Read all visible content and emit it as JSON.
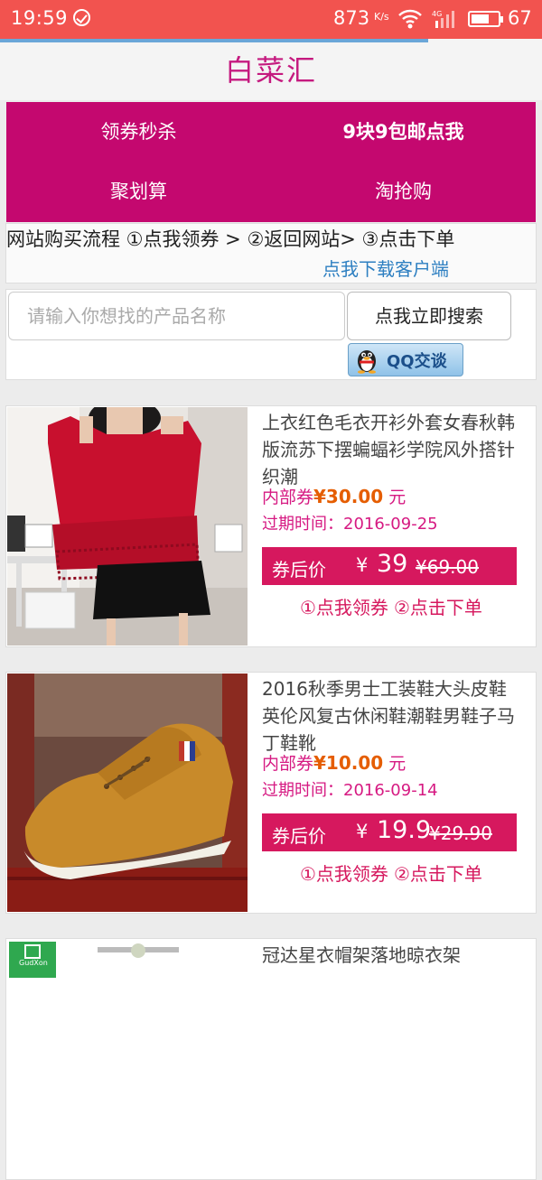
{
  "status_bar": {
    "time": "19:59",
    "speed": "873",
    "speed_unit": "K/s",
    "battery": "67",
    "battery_level": 0.67
  },
  "page_load_progress": 0.79,
  "header": {
    "title": "白菜汇"
  },
  "menu": {
    "items": [
      {
        "label": "领券秒杀"
      },
      {
        "label": "9块9包邮点我"
      },
      {
        "label": "聚划算"
      },
      {
        "label": "淘抢购"
      }
    ]
  },
  "flow": {
    "steps": "网站购买流程 ①点我领券 > ②返回网站> ③点击下单",
    "download": "点我下载客户端"
  },
  "search": {
    "placeholder": "请输入你想找的产品名称",
    "button": "点我立即搜索",
    "qq_button": "QQ交谈"
  },
  "products": [
    {
      "name": "上衣红色毛衣开衫外套女春秋韩版流苏下摆蝙蝠衫学院风外搭针织潮",
      "coupon_label": "内部券",
      "coupon_amount": "¥30.00",
      "coupon_unit": "元",
      "expire": "过期时间：2016-09-25",
      "price_label": "券后价",
      "currency": "¥",
      "price_now": "39",
      "price_old": "¥69.00",
      "action_get": "①点我领券",
      "action_buy": "②点击下单"
    },
    {
      "name": "2016秋季男士工装鞋大头皮鞋英伦风复古休闲鞋潮鞋男鞋子马丁鞋靴",
      "coupon_label": "内部券",
      "coupon_amount": "¥10.00",
      "coupon_unit": "元",
      "expire": "过期时间：2016-09-14",
      "price_label": "券后价",
      "currency": "¥",
      "price_now": "19.9",
      "price_old": "¥29.90",
      "action_get": "①点我领券",
      "action_buy": "②点击下单"
    },
    {
      "name": "冠达星衣帽架落地晾衣架",
      "brand": "GudXon"
    }
  ]
}
